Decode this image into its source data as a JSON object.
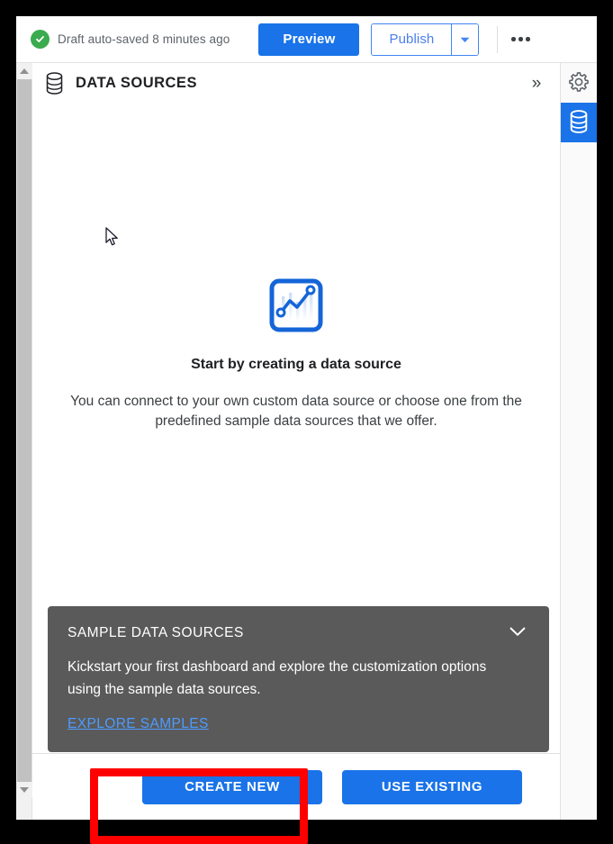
{
  "toolbar": {
    "status_icon": "check-circle-icon",
    "status_text": "Draft auto-saved 8 minutes ago",
    "preview_label": "Preview",
    "publish_label": "Publish",
    "publish_caret_icon": "caret-down-icon",
    "overflow_icon": "more-horizontal-icon"
  },
  "panel": {
    "icon": "database-icon",
    "title": "DATA SOURCES",
    "collapse_icon": "chevron-double-right-icon",
    "collapse_label": "»"
  },
  "empty_state": {
    "icon": "line-chart-icon",
    "title": "Start by creating a data source",
    "description": "You can connect to your own custom data source or choose one from the predefined sample data sources that we offer."
  },
  "sample_card": {
    "title": "SAMPLE DATA SOURCES",
    "collapse_icon": "chevron-down-icon",
    "description": "Kickstart your first dashboard and explore the customization options using the sample data sources.",
    "link_label": "EXPLORE SAMPLES"
  },
  "footer": {
    "create_new_label": "CREATE NEW",
    "use_existing_label": "USE EXISTING"
  },
  "right_rail": {
    "items": [
      {
        "icon": "gear-icon",
        "active": false
      },
      {
        "icon": "database-icon",
        "active": true
      }
    ]
  },
  "scrollbar": {
    "up_icon": "triangle-up-icon",
    "down_icon": "triangle-down-icon"
  },
  "cursor": {
    "icon": "arrow-cursor-icon"
  },
  "annotation": {
    "target": "create-new-button",
    "color": "#ff0000"
  },
  "colors": {
    "accent_blue": "#1a73e8",
    "link_blue": "#4d9bff",
    "success_green": "#3aab4e",
    "card_gray": "#5a5a5a",
    "annotation_red": "#ff0000"
  }
}
